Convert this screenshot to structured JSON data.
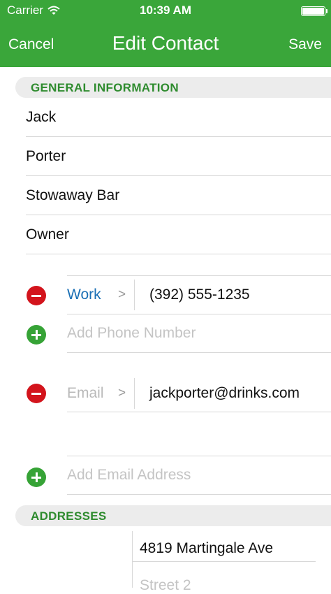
{
  "status_bar": {
    "carrier": "Carrier",
    "time": "10:39 AM"
  },
  "nav": {
    "cancel_label": "Cancel",
    "title": "Edit Contact",
    "save_label": "Save",
    "color": "#3aa63a"
  },
  "general": {
    "header": "GENERAL INFORMATION",
    "fields": [
      "Jack",
      "Porter",
      "Stowaway Bar",
      "Owner"
    ]
  },
  "phone": {
    "type_label": "Work",
    "chevron": ">",
    "value": "(392) 555-1235",
    "add_placeholder": "Add Phone Number"
  },
  "email": {
    "type_label": "Email",
    "chevron": ">",
    "value": "jackporter@drinks.com",
    "add_placeholder": "Add Email Address"
  },
  "addresses": {
    "header": "ADDRESSES",
    "street1": "4819 Martingale Ave",
    "street2_placeholder": "Street 2"
  }
}
